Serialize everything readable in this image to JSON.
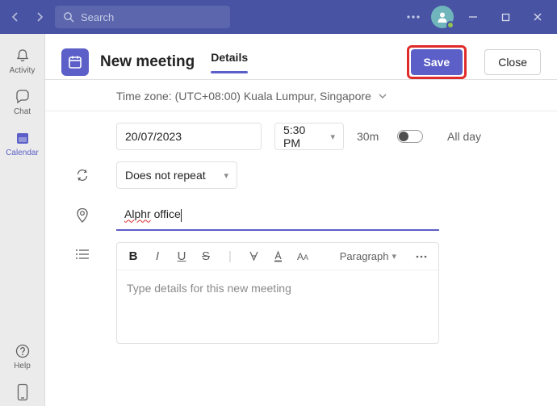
{
  "titlebar": {
    "search_placeholder": "Search"
  },
  "rail": {
    "activity": "Activity",
    "chat": "Chat",
    "calendar": "Calendar",
    "help": "Help"
  },
  "header": {
    "title": "New meeting",
    "tab_details": "Details",
    "save_label": "Save",
    "close_label": "Close"
  },
  "timezone": {
    "label": "Time zone: (UTC+08:00) Kuala Lumpur, Singapore"
  },
  "form": {
    "date": "20/07/2023",
    "time": "5:30 PM",
    "duration": "30m",
    "allday_label": "All day",
    "repeat": "Does not repeat",
    "location_word1": "Alphr",
    "location_word2": " office"
  },
  "editor": {
    "paragraph_label": "Paragraph",
    "placeholder": "Type details for this new meeting"
  }
}
